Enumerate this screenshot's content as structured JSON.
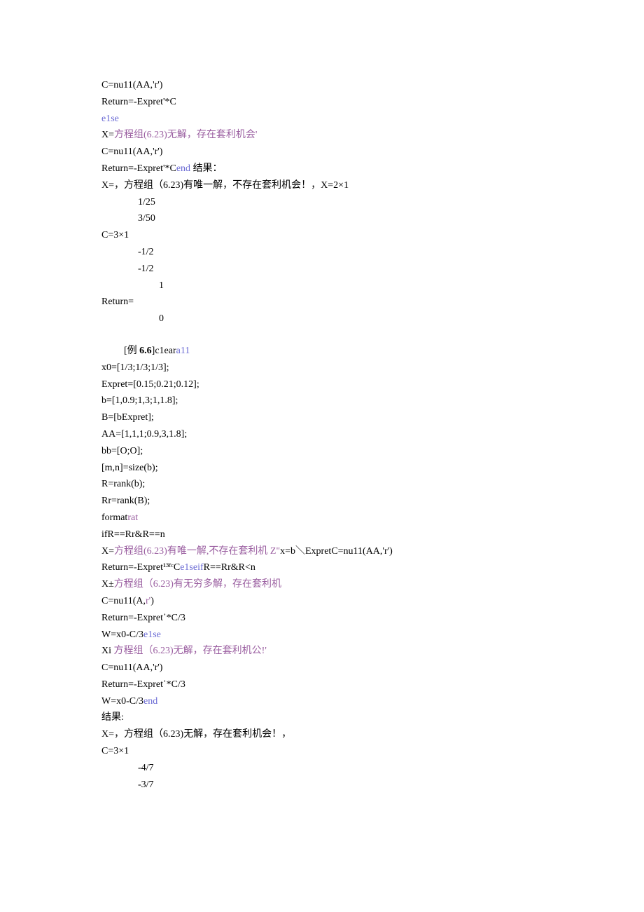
{
  "lines": [
    {
      "segs": [
        {
          "t": "C=nu11(AA,'r')"
        }
      ]
    },
    {
      "segs": [
        {
          "t": "Return=-Expret'*C"
        }
      ]
    },
    {
      "segs": [
        {
          "t": "e1se",
          "cls": "blue"
        }
      ]
    },
    {
      "segs": [
        {
          "t": "X="
        },
        {
          "t": "方程组(6.23)无解，存在套利机会'",
          "cls": "purple"
        }
      ]
    },
    {
      "segs": [
        {
          "t": "C=nu11(AA,'r')"
        }
      ]
    },
    {
      "segs": [
        {
          "t": "Return=-Expret'*C"
        },
        {
          "t": "end",
          "cls": "blue"
        },
        {
          "t": " 结果："
        }
      ]
    },
    {
      "segs": [
        {
          "t": "X=，方程组（6.23)有唯一解，不存在套利机会！，X=2×1"
        }
      ]
    },
    {
      "cls": "indent1",
      "segs": [
        {
          "t": "1/25"
        }
      ]
    },
    {
      "cls": "indent1",
      "segs": [
        {
          "t": "3/50"
        }
      ]
    },
    {
      "segs": [
        {
          "t": "C=3×1"
        }
      ]
    },
    {
      "cls": "indent1",
      "segs": [
        {
          "t": "-1/2"
        }
      ]
    },
    {
      "cls": "indent1",
      "segs": [
        {
          "t": "-1/2"
        }
      ]
    },
    {
      "cls": "indent2",
      "segs": [
        {
          "t": "1"
        }
      ]
    },
    {
      "segs": [
        {
          "t": "Return="
        }
      ]
    },
    {
      "cls": "indent2",
      "segs": [
        {
          "t": "0"
        }
      ]
    },
    {
      "blank": true
    },
    {
      "cls": "ex-label",
      "segs": [
        {
          "t": "[例 ",
          "cls": ""
        },
        {
          "t": "6.6",
          "cls": "bold"
        },
        {
          "t": "]c1ear"
        },
        {
          "t": "a11",
          "cls": "blue"
        }
      ]
    },
    {
      "segs": [
        {
          "t": "x0=[1/3;1/3;1/3];"
        }
      ]
    },
    {
      "segs": [
        {
          "t": "Expret=[0.15;0.21;0.12];"
        }
      ]
    },
    {
      "segs": [
        {
          "t": "b=[1,0.9;1,3;1,1.8];"
        }
      ]
    },
    {
      "segs": [
        {
          "t": "B=[bExpret];"
        }
      ]
    },
    {
      "segs": [
        {
          "t": "AA=[1,1,1;0.9,3,1.8];"
        }
      ]
    },
    {
      "segs": [
        {
          "t": "bb=[O;O];"
        }
      ]
    },
    {
      "segs": [
        {
          "t": "[m,n]=size(b);"
        }
      ]
    },
    {
      "segs": [
        {
          "t": "R=rank(b);"
        }
      ]
    },
    {
      "segs": [
        {
          "t": "Rr=rank(B);"
        }
      ]
    },
    {
      "segs": [
        {
          "t": "format"
        },
        {
          "t": "rat",
          "cls": "purple"
        }
      ]
    },
    {
      "segs": [
        {
          "t": "ifR==Rr&R==n"
        }
      ]
    },
    {
      "segs": [
        {
          "t": "X="
        },
        {
          "t": "方程组(6.23)有唯一解,不存在套利机 Z\"",
          "cls": "purple"
        },
        {
          "t": "x=b＼ExpretC=nu11(AA,'r')"
        }
      ]
    },
    {
      "segs": [
        {
          "t": "Return=-Expret¹³ᶠᶜC"
        },
        {
          "t": "e1seif",
          "cls": "blue"
        },
        {
          "t": "R==Rr&R<n"
        }
      ]
    },
    {
      "segs": [
        {
          "t": "X±"
        },
        {
          "t": "方程组（6.23)有无穷多解，存在套利机",
          "cls": "purple"
        }
      ]
    },
    {
      "segs": [
        {
          "t": "C=nu11(A,"
        },
        {
          "t": "r'",
          "cls": "purple"
        },
        {
          "t": ")"
        }
      ]
    },
    {
      "segs": [
        {
          "t": "Return=-Expret᾽*C/3"
        }
      ]
    },
    {
      "segs": [
        {
          "t": "W=x0-C/3"
        },
        {
          "t": "e1se",
          "cls": "blue"
        }
      ]
    },
    {
      "segs": [
        {
          "t": "Xi "
        },
        {
          "t": "方程组（6.23)无解，存在套利机公!'",
          "cls": "purple"
        }
      ]
    },
    {
      "segs": [
        {
          "t": "C=nu11(AA,'r')"
        }
      ]
    },
    {
      "segs": [
        {
          "t": "Return=-Expret᾽*C/3"
        }
      ]
    },
    {
      "segs": [
        {
          "t": "W=x0-C/3"
        },
        {
          "t": "end",
          "cls": "blue"
        }
      ]
    },
    {
      "segs": [
        {
          "t": "结果:"
        }
      ]
    },
    {
      "segs": [
        {
          "t": "X=，方程组（6.23)无解，存在套利机会！，"
        }
      ]
    },
    {
      "segs": [
        {
          "t": "C=3×1"
        }
      ]
    },
    {
      "cls": "indent1",
      "segs": [
        {
          "t": "-4/7"
        }
      ]
    },
    {
      "cls": "indent1",
      "segs": [
        {
          "t": "-3/7"
        }
      ]
    }
  ]
}
